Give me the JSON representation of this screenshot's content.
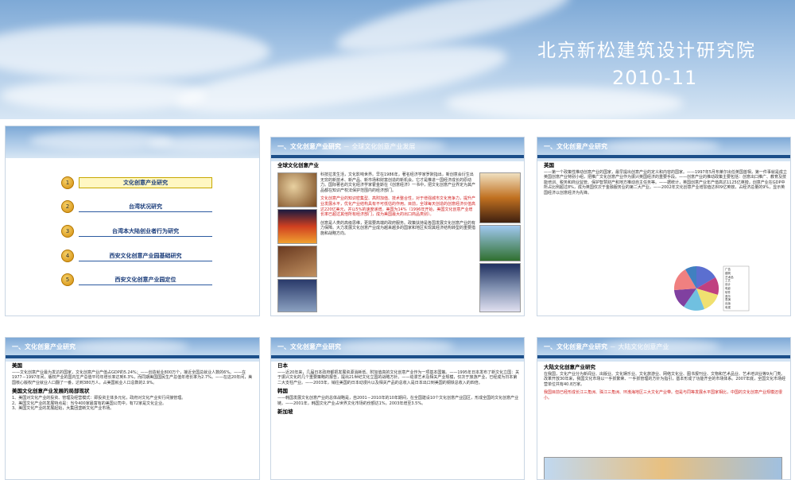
{
  "banner": {
    "title": "北京新松建筑设计研究院",
    "date": "2010-11"
  },
  "slides": [
    {
      "toc": [
        "文化创意产业研究",
        "台湾状况研究",
        "台湾本大陆创业者行为研究",
        "西安文化创意产业园基础研究",
        "西安文化创意产业园定位"
      ],
      "nums": [
        "1",
        "2",
        "3",
        "4",
        "5"
      ]
    },
    {
      "header": "一、文化创意产业研究",
      "header_sub": "－ 全球文化创意产业发展",
      "heading": "全球文化创意产业",
      "p1": "科技拉发生活，文化影响世界。早在1986年，著名经济学家罗默指出，新创意会衍生出无穷的新技术、新产品、新市场和财富创造的新机会。它才是推进一国经济成长的原动力。国际著名的文化经济学家霍金斯在《创意经济》一书中，把文化创意产业界定为其产品都在知识产权法保护范围内的经济部门。",
      "p2": "文化创意产业的知识密集型、高附加值、技术整合性，对于增强城市文化竞争力，提升产业发展水平，优化产业结构具有不可低估的作用。目前，全球每天创造的创意经济价值高达220亿美元，并以5%的速度递增。美国为14%（1996年开始，美国文化创意产业增长率已超过其他所有经济部门，成为美国最大的出口商品类别）。",
      "p3": "创意是人类的高级思维，更需要高端的政府服务。政策扶持是各国发展文化创意产业的有力保障。大力发展文化创意产业成为越来越多的国家和地区实现其经济结构转型的重要措施和战略方向。"
    },
    {
      "header": "一、文化创意产业研究",
      "heading": "英国",
      "body": "——第一个政策性推动创意产业的国家，最早提出创意产业的定义和内容的国家。——1997年5月布莱尔出任英国首相，第一件事就是成立英国创意产业特别小组，把推广文化创意产业作为振兴英国经济的重要手段。——创意产业的推动政策主要包括：创意出口推广、教育及技能培训、税务和商业监管、保护智慧财产和地方推动自主任务等。——据统计，英国创意产业年产值高达1125亿英镑，创意产业在GDP中所占比例超过8%，成为英国仅次于金融服务业的第二大产业。——2002年文化创意产业增加值达809亿英镑，占经济总量的9%，显示英国经济以创意经济为先锋。",
      "pie_legend": [
        "广告",
        "建筑",
        "艺术品",
        "工艺",
        "设计",
        "电影",
        "软件",
        "音乐",
        "表演",
        "出版",
        "电视"
      ]
    },
    {
      "header": "一、文化创意产业研究",
      "heading": "美国",
      "body": "——文化创意产业最为发达的国家，文化创意产业产值占GDP的5.24%；——创造就业800万个，接近全国总就业人数的6%。——在1977－1997年间，版权产业的国内生产总值平均年增长率达到6.3%，而同期美国国民生产总值年增长率为2.7%。——在这20年间，美国核心版权产业就业人口翻了一番，达到380万人，占美国就业人口总数的2.9%。",
      "heading2": "美国文化创意产业发展的局部现状",
      "list": [
        "美国对文化产业的投资、管理及经营模式：即投资主体多元化，政府对文化产业实行间接管理。",
        "美国文化产业的发展特点是：当今400家最富有的美国公司中，有72家是文化企业。",
        "美国文化产业的发展起始，大集团垄断文化产业市场。"
      ]
    },
    {
      "header": "一、文化创意产业研究",
      "heading": "日本",
      "body": "——近20年来，几届日本政府都把发展资源消耗低、附加值高的文化创意产业作为一项基本国策。——1995年日本发布了新文化立国：关于振兴文化的几个重要策略的报告，提出21世纪文化立国的战略方针。——动漫艺术及相关产业规模，仅次于旅游产业，已经成为日本第二大支柱产业。——2003年，销往美国的日本动漫片以及相关产品的总收入是日本出口到美国的钢铁总收入的四倍。",
      "heading2": "韩国",
      "body2": "——韩国发展文化创意产业的总体战略是，自2001－2010年的10年期间，在全国建设10个文化创意产业园区，形成全国的文化创意产业链。——2001年，韩国文化产业占世界文化市场的份额达1%，2003年增至3.5%。",
      "heading3": "新加坡"
    },
    {
      "header": "一、文化创意产业研究",
      "header_sub": "－ 大陆文化创意产业",
      "heading": "大陆文化创意产业研究",
      "body": "在我国，文化产业分为新闻业、出版业、文化娱乐业、文化旅游业、网络文化业、图书报刊业、文物和艺术品业、艺术培训业等9大门类。改革开放30年来，我国文化市场以一手抓繁荣、一手抓管理的方针为指引，基本形成了功能齐全的市场体系。2007年底，全国文化市场经营单位共有40.8万家。",
      "body_red": "我国目前已经形成长江三角洲、珠江三角洲、环渤海地区三大文化产业带。但是与同等发展水平国家相比，中国的文化创意产业规模还很小。"
    }
  ]
}
